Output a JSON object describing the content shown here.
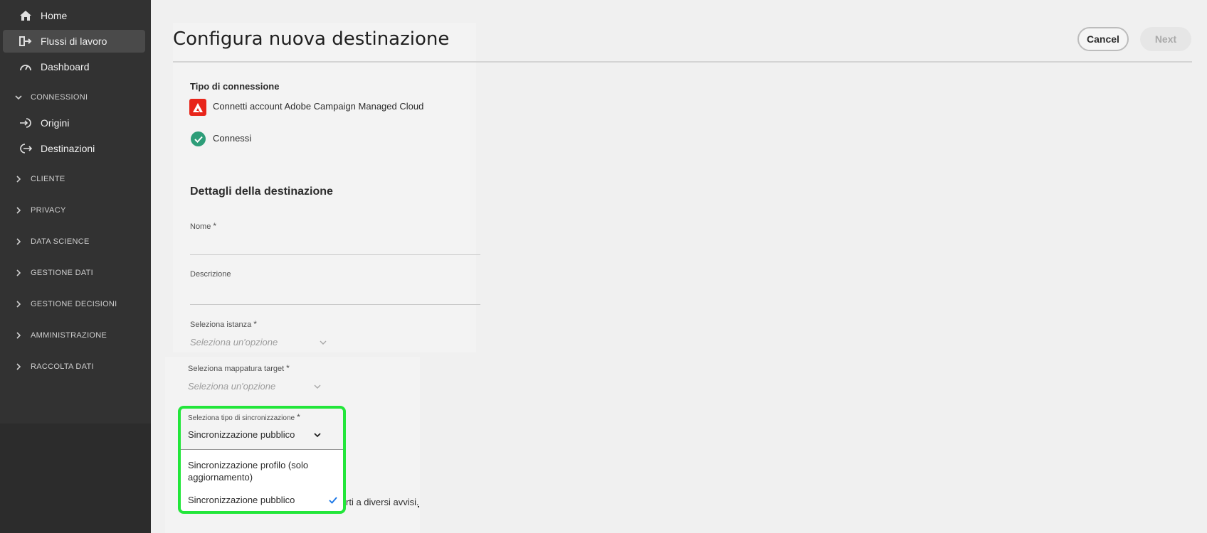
{
  "sidebar": {
    "items": [
      {
        "label": "Home",
        "icon": "home-icon"
      },
      {
        "label": "Flussi di lavoro",
        "icon": "workflow-icon"
      },
      {
        "label": "Dashboard",
        "icon": "dashboard-icon"
      }
    ],
    "connessioni": {
      "label": "CONNESSIONI",
      "items": [
        {
          "label": "Origini",
          "icon": "sign-in-icon"
        },
        {
          "label": "Destinazioni",
          "icon": "sign-out-icon"
        }
      ]
    },
    "sections": [
      "CLIENTE",
      "PRIVACY",
      "DATA SCIENCE",
      "GESTIONE DATI",
      "GESTIONE DECISIONI",
      "AMMINISTRAZIONE",
      "RACCOLTA DATI"
    ]
  },
  "header": {
    "title": "Configura nuova destinazione",
    "cancel_label": "Cancel",
    "next_label": "Next"
  },
  "connection": {
    "heading": "Tipo di connessione",
    "account_label": "Connetti account Adobe Campaign Managed Cloud",
    "status_label": "Connessi"
  },
  "details": {
    "heading": "Dettagli della destinazione",
    "name_label": "Nome",
    "description_label": "Descrizione",
    "instance_label": "Seleziona istanza",
    "instance_placeholder": "Seleziona un'opzione",
    "mapping_label": "Seleziona mappatura target",
    "mapping_placeholder": "Seleziona un'opzione",
    "sync_label": "Seleziona tipo di sincronizzazione",
    "sync_value": "Sincronizzazione pubblico",
    "sync_options": [
      "Sincronizzazione profilo (solo aggiornamento)",
      "Sincronizzazione pubblico"
    ],
    "required_mark": "*",
    "partial_text": "rti a diversi avvisi."
  },
  "colors": {
    "highlight": "#22e63a",
    "sidebar": "#323232",
    "adobe_red": "#e8251a",
    "success_green": "#2d9d78",
    "check_blue": "#1473e6"
  }
}
